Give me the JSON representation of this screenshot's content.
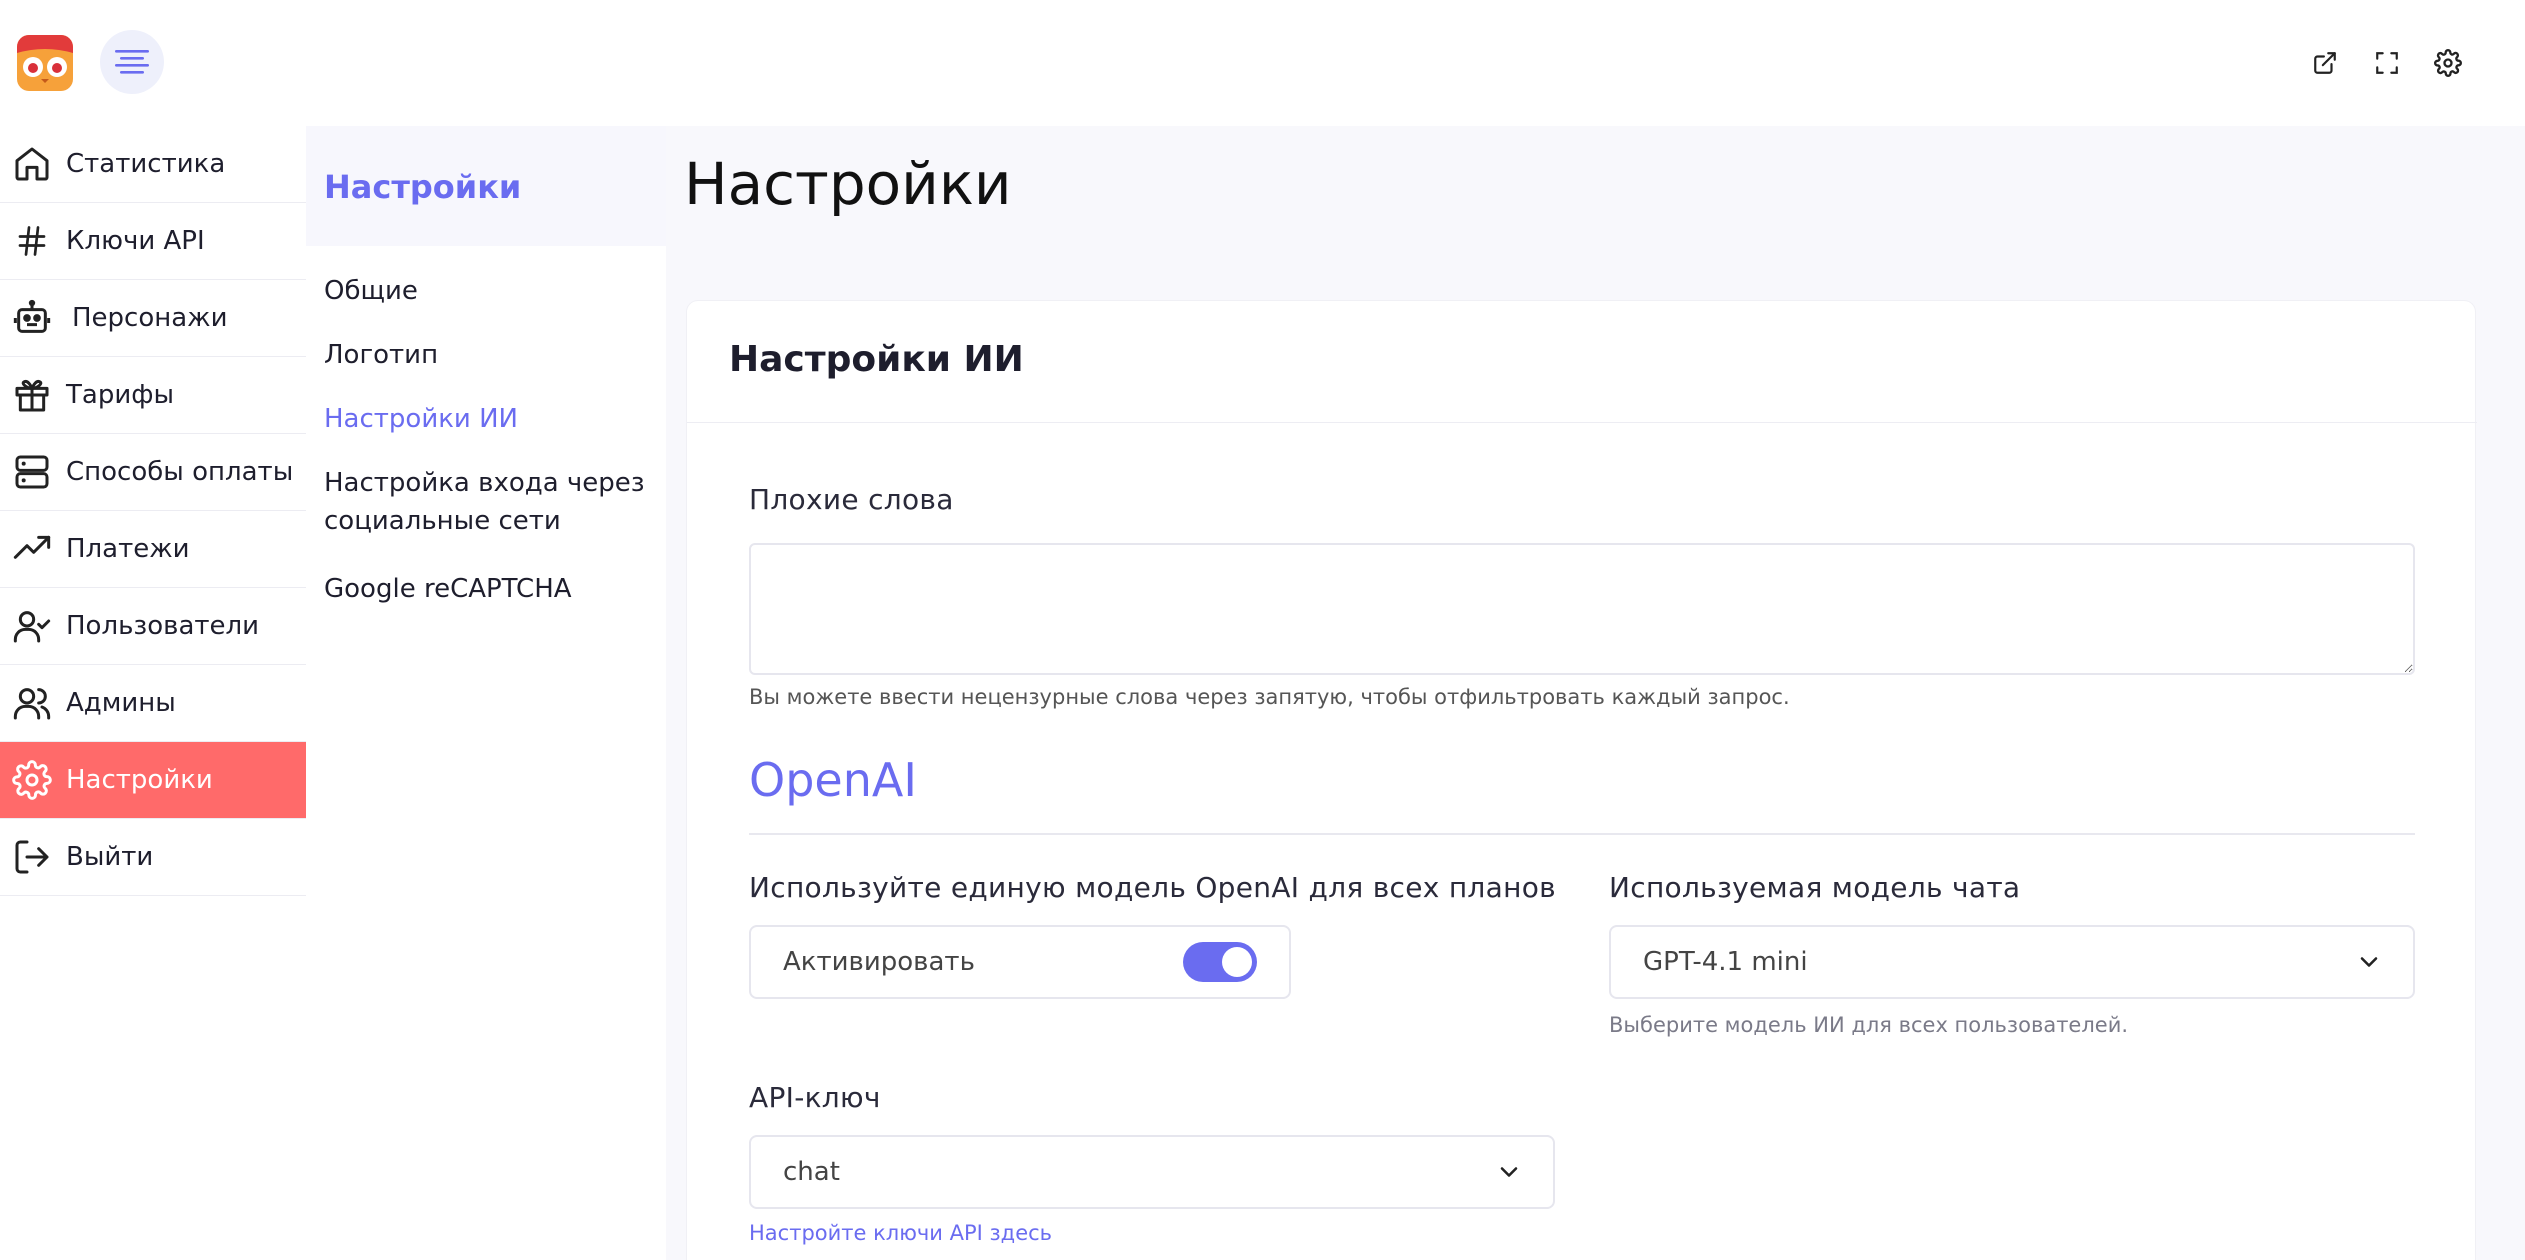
{
  "topbar": {
    "menu_icon": "menu-lines-icon",
    "actions": [
      {
        "name": "external-link-icon"
      },
      {
        "name": "fullscreen-icon"
      },
      {
        "name": "gear-icon"
      }
    ]
  },
  "sidebar": {
    "items": [
      {
        "label": "Статистика",
        "icon": "home-icon"
      },
      {
        "label": "Ключи API",
        "icon": "hash-icon"
      },
      {
        "label": "Персонажи",
        "icon": "robot-icon"
      },
      {
        "label": "Тарифы",
        "icon": "gift-icon"
      },
      {
        "label": "Способы оплаты",
        "icon": "server-icon"
      },
      {
        "label": "Платежи",
        "icon": "trending-up-icon"
      },
      {
        "label": "Пользователи",
        "icon": "user-check-icon"
      },
      {
        "label": "Админы",
        "icon": "users-icon"
      },
      {
        "label": "Настройки",
        "icon": "gear-icon",
        "active": true
      },
      {
        "label": "Выйти",
        "icon": "logout-icon"
      }
    ]
  },
  "subnav": {
    "title": "Настройки",
    "items": [
      {
        "label": "Общие"
      },
      {
        "label": "Логотип"
      },
      {
        "label": "Настройки ИИ",
        "active": true
      },
      {
        "label": "Настройка входа через социальные сети"
      },
      {
        "label": "Google reCAPTCHA"
      }
    ]
  },
  "main": {
    "page_title": "Настройки",
    "card_title": "Настройки ИИ",
    "bad_words": {
      "label": "Плохие слова",
      "value": "",
      "help": "Вы можете ввести нецензурные слова через запятую, чтобы отфильтровать каждый запрос."
    },
    "openai": {
      "section_title": "OpenAI",
      "single_model": {
        "label": "Используйте единую модель OpenAI для всех планов",
        "toggle_label": "Активировать",
        "enabled": true
      },
      "chat_model": {
        "label": "Используемая модель чата",
        "selected": "GPT-4.1 mini",
        "help": "Выберите модель ИИ для всех пользователей."
      },
      "api_key": {
        "label": "API-ключ",
        "selected": "chat",
        "link": "Настройте ключи API здесь"
      }
    }
  },
  "colors": {
    "accent": "#6a6cf0",
    "active_nav": "#ff6a6a"
  }
}
